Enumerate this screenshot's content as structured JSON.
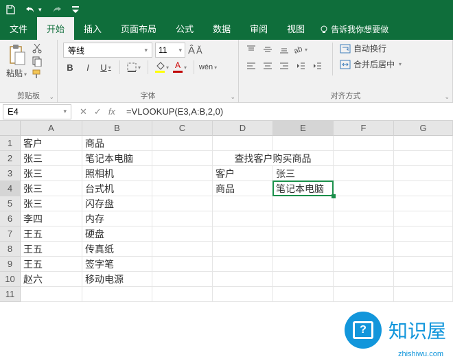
{
  "titlebar": {
    "save": "save",
    "undo": "undo",
    "redo": "redo"
  },
  "menu": {
    "file": "文件",
    "home": "开始",
    "insert": "插入",
    "layout": "页面布局",
    "formulas": "公式",
    "data": "数据",
    "review": "审阅",
    "view": "视图",
    "tell": "告诉我你想要做"
  },
  "ribbon": {
    "paste": "粘贴",
    "clipboard": "剪贴板",
    "font": "字体",
    "align": "对齐方式",
    "font_name": "等线",
    "font_size": "11",
    "wrap": "自动换行",
    "merge": "合并后居中"
  },
  "namebox": "E4",
  "formula": "=VLOOKUP(E3,A:B,2,0)",
  "cols": [
    "A",
    "B",
    "C",
    "D",
    "E",
    "F",
    "G"
  ],
  "rows": [
    "1",
    "2",
    "3",
    "4",
    "5",
    "6",
    "7",
    "8",
    "9",
    "10",
    "11"
  ],
  "cells": {
    "A1": "客户",
    "B1": "商品",
    "A2": "张三",
    "B2": "笔记本电脑",
    "D2E2": "查找客户购买商品",
    "A3": "张三",
    "B3": "照相机",
    "D3": "客户",
    "E3": "张三",
    "A4": "张三",
    "B4": "台式机",
    "D4": "商品",
    "E4": "笔记本电脑",
    "A5": "张三",
    "B5": "闪存盘",
    "A6": "李四",
    "B6": "内存",
    "A7": "王五",
    "B7": "硬盘",
    "A8": "王五",
    "B8": "传真纸",
    "A9": "王五",
    "B9": "签字笔",
    "A10": "赵六",
    "B10": "移动电源"
  },
  "watermark": {
    "text": "知识屋",
    "url": "zhishiwu.com"
  }
}
